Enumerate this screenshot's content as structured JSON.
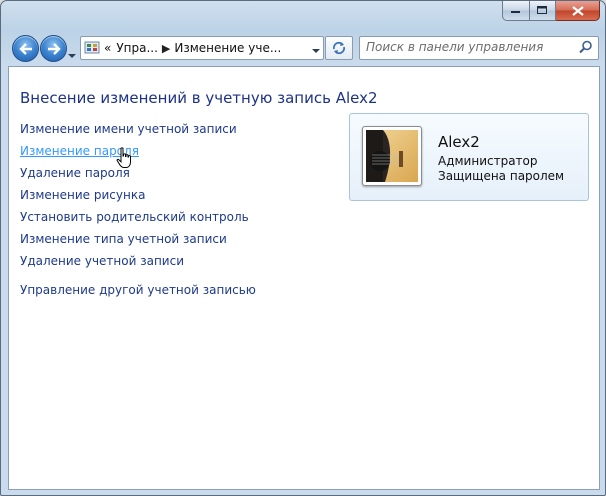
{
  "window": {
    "caption_buttons": [
      "minimize",
      "maximize",
      "close"
    ]
  },
  "navbar": {
    "breadcrumb": {
      "overflow": "«",
      "items": [
        "Упра...",
        "Изменение уче..."
      ]
    },
    "search": {
      "placeholder": "Поиск в панели управления"
    }
  },
  "main": {
    "title": "Внесение изменений в учетную запись Alex2",
    "links": [
      "Изменение имени учетной записи",
      "Изменение пароля",
      "Удаление пароля",
      "Изменение рисунка",
      "Установить родительский контроль",
      "Изменение типа учетной записи",
      "Удаление учетной записи"
    ],
    "other_link": "Управление другой учетной записью",
    "hovered_link_index": 1
  },
  "account": {
    "name": "Alex2",
    "role": "Администратор",
    "status": "Защищена паролем",
    "avatar_icon": "guitar-picture-icon"
  },
  "colors": {
    "link": "#1e3a8a",
    "link_hover": "#3399ff",
    "title": "#1e3287",
    "card_border": "#a7c4e0"
  }
}
